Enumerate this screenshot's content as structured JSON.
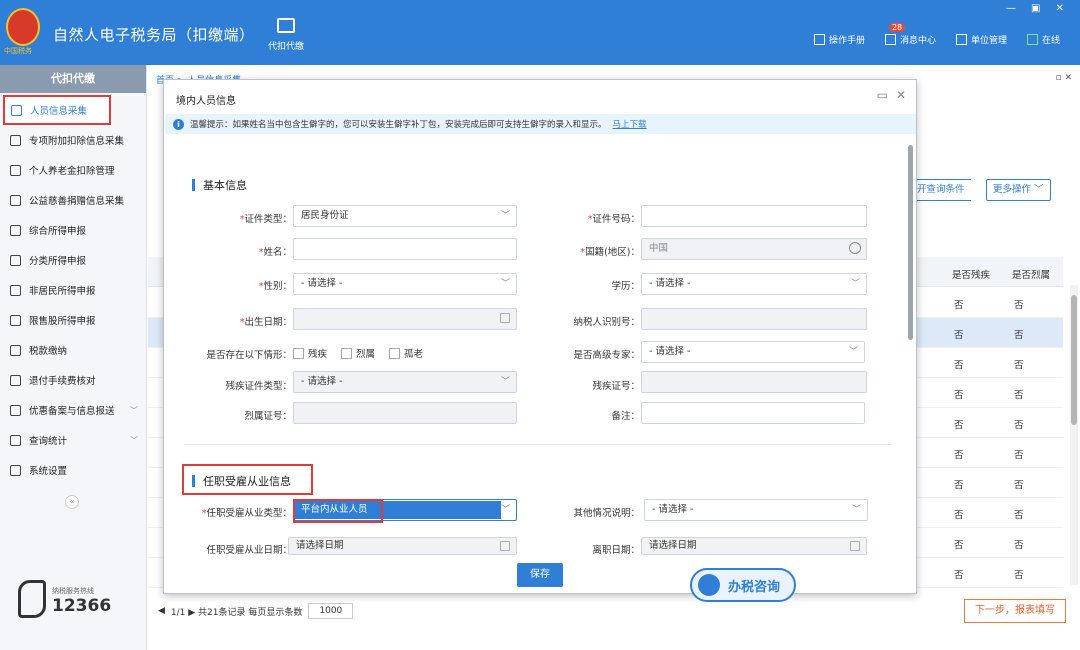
{
  "app": {
    "title": "自然人电子税务局（扣缴端）",
    "logo_text": "中国税务"
  },
  "topnav": {
    "item": "代扣代缴"
  },
  "toolbar": {
    "manual": "操作手册",
    "messages": "消息中心",
    "msg_count": "28",
    "unit": "单位管理",
    "online": "在线"
  },
  "sidebar": {
    "header": "代扣代缴",
    "items": [
      {
        "label": "人员信息采集"
      },
      {
        "label": "专项附加扣除信息采集"
      },
      {
        "label": "个人养老金扣除管理"
      },
      {
        "label": "公益慈善捐赠信息采集"
      },
      {
        "label": "综合所得申报"
      },
      {
        "label": "分类所得申报"
      },
      {
        "label": "非居民所得申报"
      },
      {
        "label": "限售股所得申报"
      },
      {
        "label": "税款缴纳"
      },
      {
        "label": "退付手续费核对"
      },
      {
        "label": "优惠备案与信息报送"
      },
      {
        "label": "查询统计"
      },
      {
        "label": "系统设置"
      }
    ],
    "collapse": "«",
    "hotline_label": "纳税服务热线",
    "hotline_number": "12366"
  },
  "main": {
    "breadcrumb": "首页 > 人员信息采集",
    "btn_more_query": "开查询条件",
    "btn_more_ops": "更多操作 ﹀",
    "columns": [
      "是否残疾",
      "是否烈属"
    ],
    "rows": [
      [
        "否",
        "否"
      ],
      [
        "否",
        "否"
      ],
      [
        "否",
        "否"
      ],
      [
        "否",
        "否"
      ],
      [
        "否",
        "否"
      ],
      [
        "否",
        "否"
      ],
      [
        "否",
        "否"
      ],
      [
        "否",
        "否"
      ],
      [
        "否",
        "否"
      ],
      [
        "否",
        "否"
      ]
    ],
    "pager": "1/1 ▶ 共21条记录  每页显示条数",
    "page_size": "1000",
    "btn_next": "下一步，报表填写"
  },
  "modal": {
    "title": "境内人员信息",
    "notice": "温馨提示：如果姓名当中包含生僻字的，您可以安装生僻字补丁包，安装完成后即可支持生僻字的录入和显示。",
    "notice_link": "马上下载",
    "section1": "基本信息",
    "section2": "任职受雇从业信息",
    "fields": {
      "id_type_label": "证件类型：",
      "id_type_value": "居民身份证",
      "id_no_label": "证件号码：",
      "name_label": "姓名：",
      "nationality_label": "国籍(地区)：",
      "nationality_value": "中国",
      "gender_label": "性别：",
      "gender_value": "- 请选择 -",
      "education_label": "学历：",
      "education_value": "- 请选择 -",
      "birth_label": "出生日期：",
      "taxpayer_id_label": "纳税人识别号：",
      "situation_label": "是否存在以下情形：",
      "situation_options": [
        "残疾",
        "烈属",
        "孤老"
      ],
      "expert_label": "是否高级专家：",
      "expert_value": "- 请选择 -",
      "disability_cert_type_label": "残疾证件类型：",
      "disability_cert_type_value": "- 请选择 -",
      "disability_cert_no_label": "残疾证号：",
      "martyr_cert_label": "烈属证号：",
      "remark_label": "备注：",
      "employ_type_label": "任职受雇从业类型：",
      "employ_type_value": "平台内从业人员",
      "other_label": "其他情况说明：",
      "other_value": "- 请选择 -",
      "employ_date_label": "任职受雇从业日期：",
      "employ_date_value": "请选择日期",
      "leave_date_label": "离职日期：",
      "leave_date_value": "请选择日期"
    },
    "save": "保存"
  },
  "consult": "办税咨询"
}
